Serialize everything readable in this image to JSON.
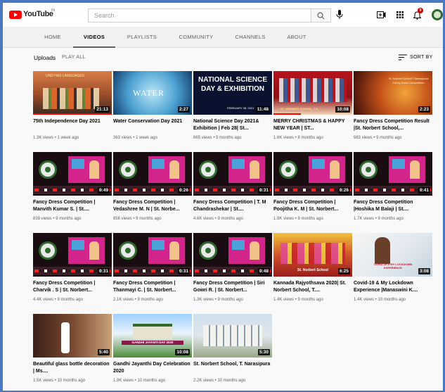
{
  "app": {
    "logo_text": "YouTube",
    "logo_sup": "IN"
  },
  "search": {
    "placeholder": "Search",
    "value": ""
  },
  "nav": {
    "tabs": [
      "HOME",
      "VIDEOS",
      "PLAYLISTS",
      "COMMUNITY",
      "CHANNELS",
      "ABOUT"
    ],
    "active": "VIDEOS"
  },
  "section": {
    "title": "Uploads",
    "play_all": "PLAY ALL",
    "sort_label": "SORT BY"
  },
  "notifications": {
    "count": "9"
  },
  "colors": {
    "brand_red": "#ff0000",
    "accent_blue_frame": "#4a78c2"
  },
  "videos": [
    {
      "title": "75th Independence Day 2021",
      "meta": "1.3K views • 1 week ago",
      "duration": "21:13",
      "thumb_text": "UND HAS LANGUAGES",
      "icon": "independence-day-thumbnail",
      "watched": 1.0
    },
    {
      "title": "Water Conservation Day 2021",
      "meta": "363 views • 1 week ago",
      "duration": "2:27",
      "thumb_text": "WATER",
      "icon": "water-day-thumbnail",
      "watched": 0.0
    },
    {
      "title": "National Science Day 2021& Exhibition | Feb 28| St...",
      "meta": "665 views • 5 months ago",
      "duration": "11:48",
      "thumb_text": "NATIONAL SCIENCE DAY & EXHIBITION",
      "thumb_date": "FEBRUARY 28, 2021",
      "icon": "science-day-thumbnail",
      "watched": 0.0
    },
    {
      "title": "MERRY CHRISTMAS & HAPPY NEW YEAR | ST...",
      "meta": "1.6K views • 8 months ago",
      "duration": "10:08",
      "thumb_text": "ST. NORBERT SCHOOL, T.N.",
      "icon": "christmas-thumbnail",
      "watched": 0.35
    },
    {
      "title": "Fancy Dress Competition Result |St. Norbert School,...",
      "meta": "983 views • 9 months ago",
      "duration": "2:23",
      "thumb_text": "St. Norbert School T.Narasipura Fancy Dress Competition",
      "icon": "result-thumbnail",
      "watched": 0.0
    },
    {
      "title": "Fancy Dress Competition | Manvith Kumar S. | St....",
      "meta": "839 views • 9 months ago",
      "duration": "0:49",
      "icon": "fancy-dress-thumbnail",
      "watched": 0.0
    },
    {
      "title": "Fancy Dress Competition | Vedashree M. N | St. Norbe...",
      "meta": "856 views • 9 months ago",
      "duration": "0:26",
      "icon": "fancy-dress-thumbnail",
      "watched": 0.0
    },
    {
      "title": "Fancy Dress Competition | T. M Chandrashekar | St....",
      "meta": "4.6K views • 9 months ago",
      "duration": "0:31",
      "icon": "fancy-dress-thumbnail",
      "watched": 0.0
    },
    {
      "title": "Fancy Dress Competition | Poojitha K. M | St. Norbert...",
      "meta": "1.9K views • 9 months ago",
      "duration": "0:26",
      "icon": "fancy-dress-thumbnail",
      "watched": 0.0
    },
    {
      "title": "Fancy Dress Competition |Hoshika M Balaji | St....",
      "meta": "1.7K views • 9 months ago",
      "duration": "0:41",
      "icon": "fancy-dress-thumbnail",
      "watched": 0.0
    },
    {
      "title": "Fancy Dress Competition | Charvik . S | St. Norbert...",
      "meta": "4.4K views • 9 months ago",
      "duration": "0:31",
      "icon": "fancy-dress-thumbnail",
      "watched": 0.0
    },
    {
      "title": "Fancy Dress Competition | Thanmayi C. | St. Norbert...",
      "meta": "2.1K views • 9 months ago",
      "duration": "0:31",
      "icon": "fancy-dress-thumbnail",
      "watched": 0.0
    },
    {
      "title": "Fancy Dress Competition | Siri Gowri R. | St. Norbert...",
      "meta": "1.3K views • 9 months ago",
      "duration": "0:48",
      "icon": "fancy-dress-thumbnail",
      "watched": 0.0
    },
    {
      "title": "Kannada Rajyothsava 2020| St. Norbert School, T....",
      "meta": "1.4K views • 9 months ago",
      "duration": "6:25",
      "thumb_text": "St. Norbert School",
      "icon": "rajyothsava-thumbnail",
      "watched": 0.0
    },
    {
      "title": "Covid-19 & My Lockdown Experience |Manaswini K....",
      "meta": "1.4K views • 10 months ago",
      "duration": "3:08",
      "thumb_text": "COVID-19 & MY LOCKDOWN EXPERIENCE",
      "icon": "covid-thumbnail",
      "watched": 0.0
    },
    {
      "title": "Beautiful glass bottle decoration | Ms....",
      "meta": "1.5K views • 10 months ago",
      "duration": "5:40",
      "icon": "bottle-decoration-thumbnail",
      "watched": 0.0
    },
    {
      "title": "Gandhi Jayanthi Day Celebration 2020",
      "meta": "1.9K views • 10 months ago",
      "duration": "10:08",
      "thumb_text": "GANDHI JAYANTI DAY 2020",
      "icon": "gandhi-jayanthi-thumbnail",
      "watched": 0.0
    },
    {
      "title": "St. Norbert School, T. Narasipura",
      "meta": "2.2K views • 10 months ago",
      "duration": "5:30",
      "icon": "school-building-thumbnail",
      "watched": 0.0
    }
  ]
}
